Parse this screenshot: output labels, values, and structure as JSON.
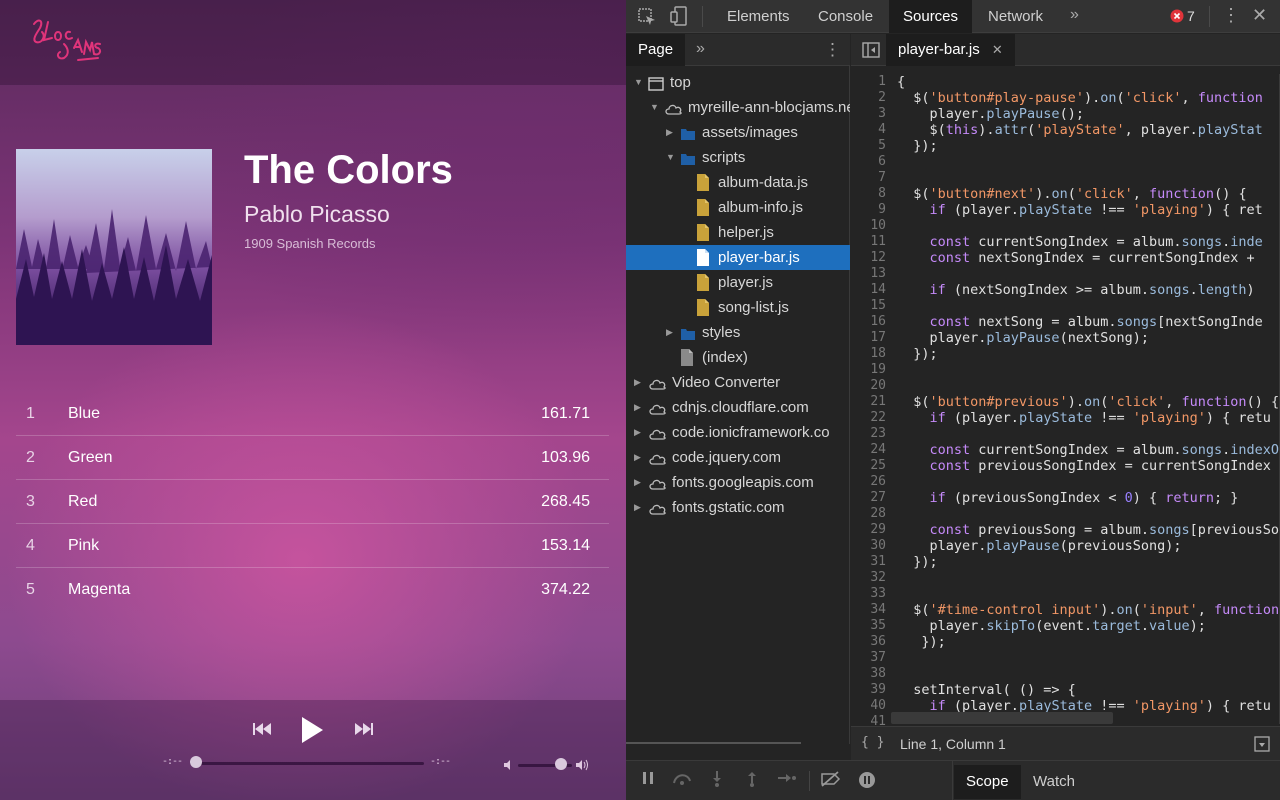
{
  "app": {
    "logo_text": "Bloc Jams",
    "album": {
      "title": "The Colors",
      "artist": "Pablo Picasso",
      "release": "1909 Spanish Records"
    },
    "songs": [
      {
        "number": "1",
        "title": "Blue",
        "duration": "161.71"
      },
      {
        "number": "2",
        "title": "Green",
        "duration": "103.96"
      },
      {
        "number": "3",
        "title": "Red",
        "duration": "268.45"
      },
      {
        "number": "4",
        "title": "Pink",
        "duration": "153.14"
      },
      {
        "number": "5",
        "title": "Magenta",
        "duration": "374.22"
      }
    ],
    "player": {
      "current_time": "-:--",
      "total_time": "-:--",
      "progress": 0.0,
      "volume": 0.8
    }
  },
  "devtools": {
    "tabs": [
      "Elements",
      "Console",
      "Sources",
      "Network"
    ],
    "active_tab": "Sources",
    "error_count": "7",
    "navigator": {
      "tab": "Page",
      "tree": [
        {
          "label": "top",
          "type": "frame",
          "depth": 0,
          "expanded": true
        },
        {
          "label": "myreille-ann-blocjams.ne",
          "type": "cloud",
          "depth": 1,
          "expanded": true
        },
        {
          "label": "assets/images",
          "type": "folder",
          "depth": 2,
          "expanded": false
        },
        {
          "label": "scripts",
          "type": "folder",
          "depth": 2,
          "expanded": true
        },
        {
          "label": "album-data.js",
          "type": "js",
          "depth": 3
        },
        {
          "label": "album-info.js",
          "type": "js",
          "depth": 3
        },
        {
          "label": "helper.js",
          "type": "js",
          "depth": 3
        },
        {
          "label": "player-bar.js",
          "type": "js",
          "depth": 3,
          "selected": true
        },
        {
          "label": "player.js",
          "type": "js",
          "depth": 3
        },
        {
          "label": "song-list.js",
          "type": "js",
          "depth": 3
        },
        {
          "label": "styles",
          "type": "folder",
          "depth": 2,
          "expanded": false
        },
        {
          "label": "(index)",
          "type": "doc",
          "depth": 2
        },
        {
          "label": "Video Converter",
          "type": "cloud",
          "depth": 0,
          "expanded": false
        },
        {
          "label": "cdnjs.cloudflare.com",
          "type": "cloud",
          "depth": 0,
          "expanded": false
        },
        {
          "label": "code.ionicframework.co",
          "type": "cloud",
          "depth": 0,
          "expanded": false
        },
        {
          "label": "code.jquery.com",
          "type": "cloud",
          "depth": 0,
          "expanded": false
        },
        {
          "label": "fonts.googleapis.com",
          "type": "cloud",
          "depth": 0,
          "expanded": false
        },
        {
          "label": "fonts.gstatic.com",
          "type": "cloud",
          "depth": 0,
          "expanded": false
        }
      ]
    },
    "editor": {
      "file_tab": "player-bar.js",
      "lines": [
        "{",
        "  $('button#play-pause').on('click', function",
        "    player.playPause();",
        "    $(this).attr('playState', player.playStat",
        "  });",
        "",
        "",
        "  $('button#next').on('click', function() {",
        "    if (player.playState !== 'playing') { ret",
        "",
        "    const currentSongIndex = album.songs.inde",
        "    const nextSongIndex = currentSongIndex +",
        "",
        "    if (nextSongIndex >= album.songs.length)",
        "",
        "    const nextSong = album.songs[nextSongInde",
        "    player.playPause(nextSong);",
        "  });",
        "",
        "",
        "  $('button#previous').on('click', function() {",
        "    if (player.playState !== 'playing') { retu",
        "",
        "    const currentSongIndex = album.songs.indexO",
        "    const previousSongIndex = currentSongIndex",
        "",
        "    if (previousSongIndex < 0) { return; }",
        "",
        "    const previousSong = album.songs[previousSo",
        "    player.playPause(previousSong);",
        "  });",
        "",
        "",
        "  $('#time-control input').on('input', function",
        "    player.skipTo(event.target.value);",
        "   });",
        "",
        "",
        "  setInterval( () => {",
        "    if (player.playState !== 'playing') { retu",
        ""
      ],
      "status": "Line 1, Column 1",
      "format_icon": "{ }"
    },
    "sidebar_tabs": [
      "Scope",
      "Watch"
    ],
    "active_sidebar_tab": "Scope"
  }
}
